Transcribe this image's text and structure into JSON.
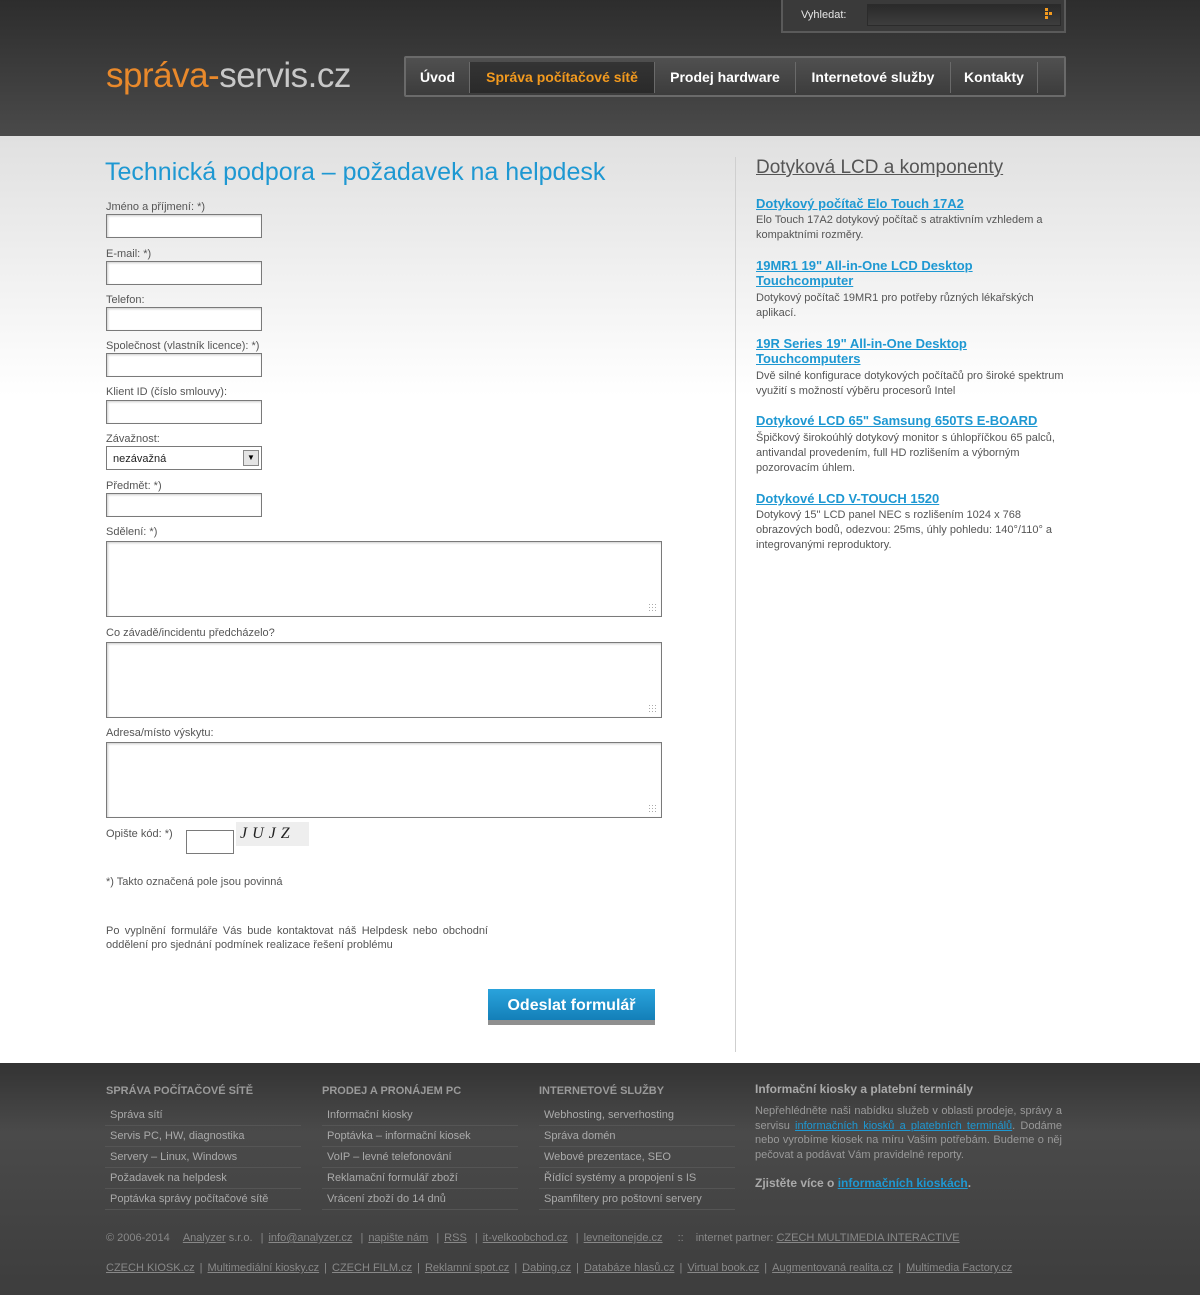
{
  "search": {
    "label": "Vyhledat:"
  },
  "logo": {
    "part1": "správa-",
    "part2": "servis.cz"
  },
  "nav": [
    {
      "label": "Úvod"
    },
    {
      "label": "Správa počítačové sítě"
    },
    {
      "label": "Prodej hardware"
    },
    {
      "label": "Internetové služby"
    },
    {
      "label": "Kontakty"
    }
  ],
  "colors": {
    "accent_blue": "#1e98d2",
    "accent_orange": "#f39a1e"
  },
  "page_title": "Technická podpora – požadavek na helpdesk",
  "form": {
    "name_label": "Jméno a příjmení: *)",
    "email_label": "E-mail: *)",
    "phone_label": "Telefon:",
    "company_label": "Společnost (vlastník licence): *)",
    "client_id_label": "Klient ID (číslo smlouvy):",
    "severity_label": "Závažnost:",
    "severity_value": "nezávažná",
    "subject_label": "Předmět: *)",
    "message_label": "Sdělení: *)",
    "preceded_label": "Co závadě/incidentu předcházelo?",
    "address_label": "Adresa/místo výskytu:",
    "captcha_label": "Opište kód: *)",
    "captcha_text": "JUJZ",
    "required_note": "*) Takto označená pole jsou povinná",
    "info_text": "Po vyplnění formuláře Vás bude kontaktovat náš Helpdesk nebo obchodní oddělení pro sjednání podmínek realizace řešení problému",
    "submit_label": "Odeslat formulář"
  },
  "sidebar": {
    "title": "Dotyková LCD a komponenty",
    "items": [
      {
        "title": "Dotykový počítač Elo Touch 17A2",
        "desc": "Elo Touch 17A2 dotykový počítač s atraktivním vzhledem a kompaktními rozměry."
      },
      {
        "title": "19MR1 19\" All-in-One LCD Desktop Touchcomputer",
        "desc": "Dotykový počítač 19MR1 pro potřeby různých lékařských aplikací."
      },
      {
        "title": "19R Series 19\" All-in-One Desktop Touchcomputers",
        "desc": "Dvě silné konfigurace dotykových počítačů pro široké spektrum využití s možností výběru procesorů Intel"
      },
      {
        "title": "Dotykové LCD 65\" Samsung 650TS E-BOARD",
        "desc": "Špičkový širokoúhlý dotykový monitor s úhlopříčkou 65 palců, antivandal provedením, full HD rozlišením a výborným pozorovacím úhlem."
      },
      {
        "title": "Dotykové LCD V-TOUCH 1520",
        "desc": "Dotykový 15\" LCD panel NEC s rozlišením 1024 x 768 obrazových bodů, odezvou: 25ms, úhly pohledu: 140°/110° a integrovanými reproduktory."
      }
    ]
  },
  "footer": {
    "columns": [
      {
        "title": "Správa počítačové sítě",
        "items": [
          "Správa sítí",
          "Servis PC, HW, diagnostika",
          "Servery – Linux, Windows",
          "Požadavek na helpdesk",
          "Poptávka správy počítačové sítě"
        ]
      },
      {
        "title": "Prodej a pronájem PC",
        "items": [
          "Informační kiosky",
          "Poptávka – informační kiosek",
          "VoIP – levné telefonování",
          "Reklamační formulář zboží",
          "Vrácení zboží do 14 dnů"
        ]
      },
      {
        "title": "Internetové služby",
        "items": [
          "Webhosting, serverhosting",
          "Správa domén",
          "Webové prezentace, SEO",
          "Řídící systémy a propojení s IS",
          "Spamfiltery pro poštovní servery"
        ]
      }
    ],
    "kiosk": {
      "title": "Informační kiosky a platební terminály",
      "text_before": "Nepřehlédněte naši nabídku služeb v oblasti prodeje, správy a servisu ",
      "text_link": "informačních kiosků a platebních terminálů",
      "text_after": ". Dodáme nebo vyrobíme kiosek na míru Vašim potřebám. Budeme o něj pečovat a podávat Vám pravidelné reporty.",
      "more_before": "Zjistěte více o ",
      "more_link": "informačních kioskách",
      "more_after": "."
    },
    "copyright": "© 2006-2014",
    "analyzer": "Analyzer",
    "sro": "s.r.o.",
    "links1": [
      "info@analyzer.cz",
      "napište nám",
      "RSS",
      "it-velkoobchod.cz",
      "levneitonejde.cz"
    ],
    "partner_label": "internet partner:",
    "partner_link": "CZECH MULTIMEDIA INTERACTIVE",
    "links2": [
      "CZECH KIOSK.cz",
      "Multimediální kiosky.cz",
      "CZECH FILM.cz",
      "Reklamní spot.cz",
      "Dabing.cz",
      "Databáze hlasů.cz",
      "Virtual book.cz",
      "Augmentovaná realita.cz",
      "Multimedia Factory.cz"
    ]
  }
}
